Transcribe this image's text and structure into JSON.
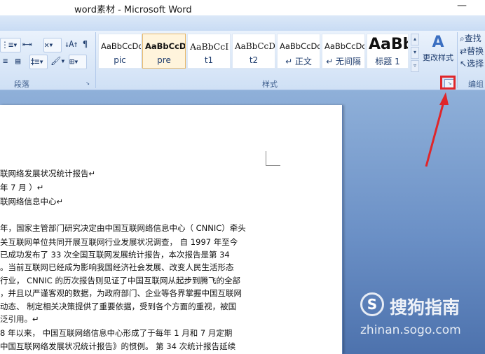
{
  "window": {
    "title": "word素材 - Microsoft Word",
    "minimize_glyph": "—"
  },
  "ribbon": {
    "paragraph": {
      "label": "段落",
      "row1": [
        "⋮≡▾",
        "⇤⇥",
        "✕▾",
        "↓A↑",
        "¶"
      ],
      "row2": [
        "≡",
        "▤",
        "‡≡▾",
        "🖌▾",
        "⊞▾"
      ],
      "launcher_glyph": "↘"
    },
    "styles": {
      "label": "样式",
      "items": [
        {
          "preview": "AaBbCcDdI",
          "name": "pic"
        },
        {
          "preview": "AaBbCcDd",
          "name": "pre",
          "selected": true
        },
        {
          "preview": "AaBbCcI",
          "name": "t1"
        },
        {
          "preview": "AaBbCcDc",
          "name": "t2"
        },
        {
          "preview": "AaBbCcDdI",
          "name": "↵ 正文"
        },
        {
          "preview": "AaBbCcDdI",
          "name": "↵ 无间隔"
        },
        {
          "preview": "AaBb",
          "name": "标题 1"
        }
      ],
      "scroll_glyphs": [
        "▴",
        "▾",
        "▿"
      ],
      "change_styles": {
        "glyph": "A",
        "label": "更改样式"
      },
      "launcher_glyph": "↘"
    },
    "editing": {
      "label": "编组",
      "items": [
        "查找",
        "替换",
        "选择"
      ],
      "icons": [
        "binoculars-icon",
        "replace-icon",
        "select-icon"
      ]
    }
  },
  "document": {
    "lines": [
      "联网络发展状况统计报告↵",
      " 年 7 月 ）↵",
      "联网络信息中心↵",
      "年，国家主管部门研究决定由中国互联网络信息中心（ CNNIC）牵头",
      "关互联网单位共同开展互联网行业发展状况调查，  自 1997 年至今",
      "已成功发布了 33 次全国互联网发展统计报告，本次报告是第 34",
      "。当前互联网已经成为影响我国经济社会发展、改变人民生活形态",
      "行业， CNNIC 的历次报告则见证了中国互联网从起步到腾飞的全部",
      "，并且以严谨客观的数据，为政府部门、企业等各界掌握中国互联网",
      "动态、 制定相关决策提供了重要依据，受到各个方面的重视，被国",
      "泛引用。↵",
      "8 年以来， 中国互联网络信息中心形成了于每年 1 月和 7 月定期",
      "中国互联网络发展状况统计报告》的惯例。 第 34 次统计报告延续"
    ]
  },
  "watermark": {
    "logo": "S",
    "brand": "搜狗指南",
    "url": "zhinan.sogo.com"
  },
  "colors": {
    "annotation": "#e0262a",
    "ribbon": "#dbe8f8",
    "workspace": "#6b90c6"
  }
}
